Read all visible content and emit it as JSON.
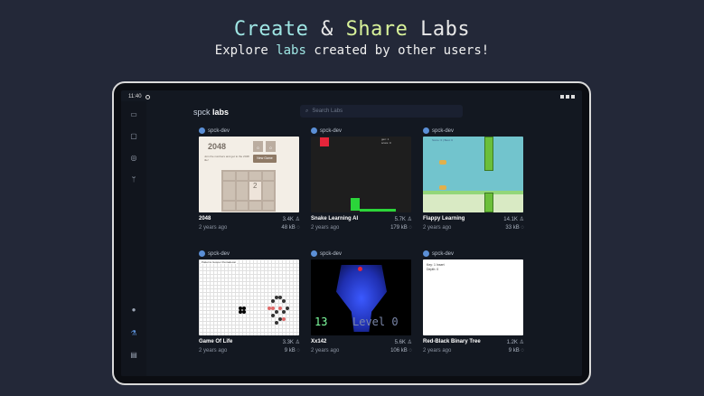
{
  "headline": {
    "w1": "Create",
    "w2": "&",
    "w3": "Share",
    "w4": "Labs"
  },
  "subline": {
    "pre": "Explore ",
    "hl": "labs",
    "post": " created by other users!"
  },
  "status": {
    "time": "11:40"
  },
  "brand": {
    "a": "spck ",
    "b": "labs"
  },
  "search": {
    "placeholder": "Search Labs"
  },
  "sidebar_icons": [
    "inbox-icon",
    "folder-icon",
    "search-icon",
    "git-branch-icon",
    "info-icon",
    "labs-flask-icon",
    "book-icon"
  ],
  "cards": [
    {
      "owner": "spck-dev",
      "name": "2048",
      "views": "3.4K",
      "age": "2 years ago",
      "size": "48 kB"
    },
    {
      "owner": "spck-dev",
      "name": "Snake Learning AI",
      "views": "5.7K",
      "age": "2 years ago",
      "size": "179 kB"
    },
    {
      "owner": "spck-dev",
      "name": "Flappy Learning",
      "views": "14.1K",
      "age": "2 years ago",
      "size": "33 kB"
    },
    {
      "owner": "spck-dev",
      "name": "Game Of Life",
      "views": "3.3K",
      "age": "2 years ago",
      "size": "9 kB"
    },
    {
      "owner": "spck-dev",
      "name": "Xx142",
      "views": "5.6K",
      "age": "2 years ago",
      "size": "106 kB"
    },
    {
      "owner": "spck-dev",
      "name": "Red-Black Binary Tree",
      "views": "1.2K",
      "age": "2 years ago",
      "size": "9 kB"
    }
  ],
  "thumb_text": {
    "t2048_title": "2048",
    "t2048_score_a": "0",
    "t2048_score_b": "0",
    "t2048_desc": "Join the numbers and get to the 2048 tile!",
    "t2048_btn": "New Game",
    "t2048_tile": "2",
    "snake_txt": "gen: 1\nscore: 0",
    "flappy_score": "Score: 0 | Best: 0",
    "life_ctl": "Patterns Gosper Pentadecat",
    "x142_level_a": "13",
    "x142_level_b": "Level 0",
    "rbt_line1": "Key: 1 Insert",
    "rbt_line2": "Depth: 0"
  },
  "colors": {
    "bg": "#232838",
    "accent_cyan": "#9fe6e4",
    "accent_lime": "#d8f29a",
    "screen": "#131821"
  }
}
